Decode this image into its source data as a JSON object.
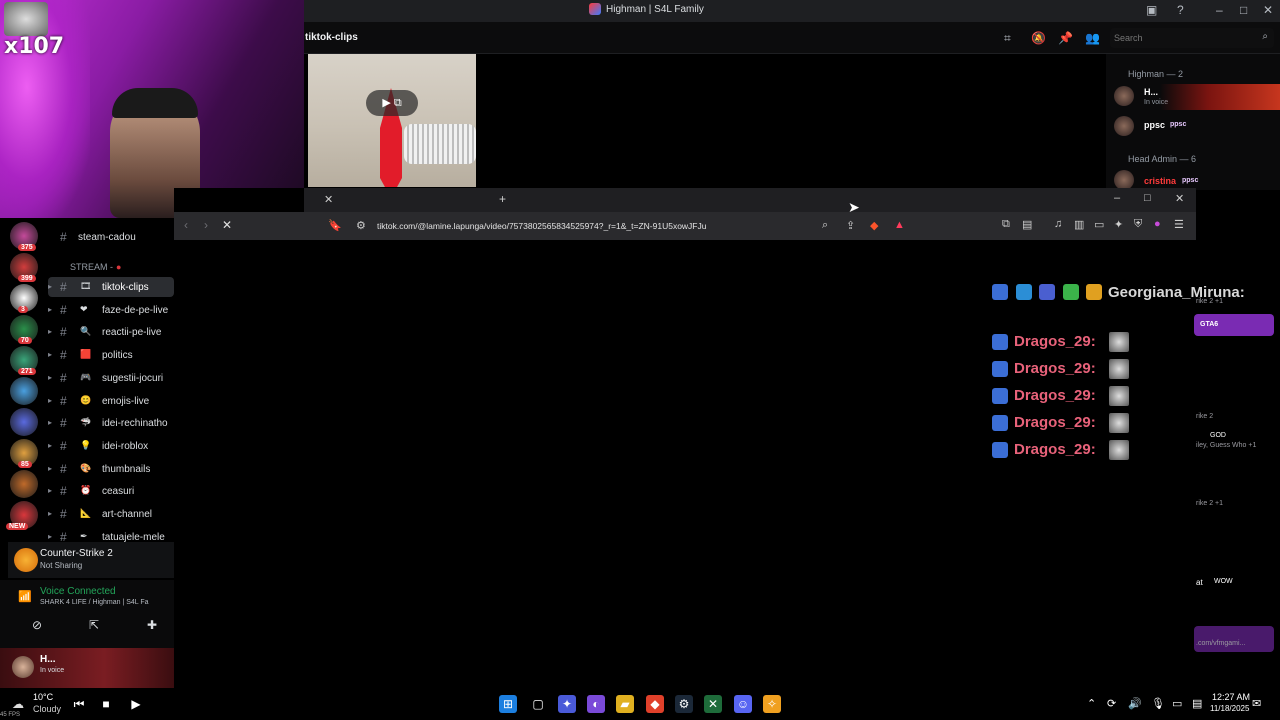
{
  "window": {
    "title": "Highman | S4L Family"
  },
  "webcam": {
    "viewer_badge": "x107"
  },
  "channel_header": {
    "name": "tiktok-clips",
    "search_placeholder": "Search"
  },
  "members": {
    "categories": [
      {
        "label": "Highman — 2"
      },
      {
        "label": "Head Admin — 6"
      }
    ],
    "items": [
      {
        "name": "H...",
        "status": "In voice",
        "color": "#ffffff"
      },
      {
        "name": "ppsc",
        "tag": "ppsc",
        "color": "#ffffff"
      },
      {
        "name": "cristina",
        "tag": "ppsc",
        "color": "#ff3b3b"
      }
    ]
  },
  "browser": {
    "url": "tiktok.com/@lamine.lapunga/video/7573802565834525974?_r=1&_t=ZN-91U5xowJFJu"
  },
  "chat_overlay": {
    "header_name": "Georgiana_Miruna:",
    "messages": [
      {
        "name": "Dragos_29:"
      },
      {
        "name": "Dragos_29:"
      },
      {
        "name": "Dragos_29:"
      },
      {
        "name": "Dragos_29:"
      },
      {
        "name": "Dragos_29:"
      }
    ],
    "name_color": "#e8627a",
    "header_color": "#d8d8d8"
  },
  "right_fragments": {
    "f1": "rike 2 +1",
    "f2": "GTA6",
    "f3": "rike 2",
    "f4": "GOD",
    "f5": "iley, Guess Who +1",
    "f6": "rike 2 +1",
    "f7": "at",
    "f8": "WOW",
    "f9": ".com/vfmgami..."
  },
  "guilds": [
    {
      "badge": "375"
    },
    {
      "badge": "399"
    },
    {
      "badge": "3"
    },
    {
      "badge": "70"
    },
    {
      "badge": "271"
    },
    {
      "badge": ""
    },
    {
      "badge": ""
    },
    {
      "badge": "85"
    },
    {
      "badge": ""
    },
    {
      "badge": "NEW"
    }
  ],
  "channels": {
    "top": {
      "name": "steam-cadou"
    },
    "category": "STREAM -",
    "items": [
      {
        "name": "tiktok-clips",
        "emoji": "🎞",
        "active": true
      },
      {
        "name": "faze-de-pe-live",
        "emoji": "❤"
      },
      {
        "name": "reactii-pe-live",
        "emoji": "🔍"
      },
      {
        "name": "politics",
        "emoji": "🟥"
      },
      {
        "name": "sugestii-jocuri",
        "emoji": "🎮"
      },
      {
        "name": "emojis-live",
        "emoji": "😊"
      },
      {
        "name": "idei-rechinatho",
        "emoji": "🦈"
      },
      {
        "name": "idei-roblox",
        "emoji": "💡"
      },
      {
        "name": "thumbnails",
        "emoji": "🎨"
      },
      {
        "name": "ceasuri",
        "emoji": "⏰"
      },
      {
        "name": "art-channel",
        "emoji": "📐"
      },
      {
        "name": "tatuajele-mele",
        "emoji": "✒"
      }
    ]
  },
  "activity": {
    "game": "Counter-Strike 2",
    "status": "Not Sharing"
  },
  "voice": {
    "status": "Voice Connected",
    "location": "SHARK 4 LIFE / Highman | S4L Fa"
  },
  "user": {
    "name": "H...",
    "status": "In voice"
  },
  "taskbar": {
    "temp": "10°C",
    "condition": "Cloudy",
    "time": "12:27 AM",
    "date": "11/18/2025",
    "fps": "45 FPS"
  }
}
